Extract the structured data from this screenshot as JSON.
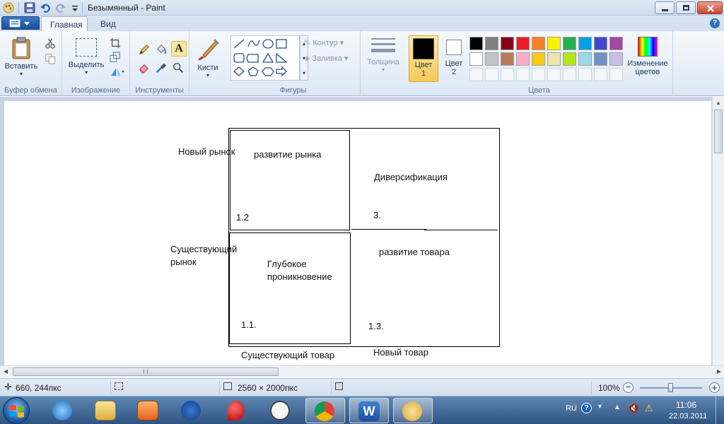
{
  "window": {
    "title": "Безымянный - Paint"
  },
  "tabs": [
    {
      "label": "Главная"
    },
    {
      "label": "Вид"
    }
  ],
  "ribbon": {
    "clipboard": {
      "paste": "Вставить",
      "group": "Буфер обмена"
    },
    "image": {
      "select": "Выделить",
      "group": "Изображение"
    },
    "tools": {
      "group": "Инструменты"
    },
    "brushes": {
      "label": "Кисти"
    },
    "shapes": {
      "outline": "Контур",
      "fill": "Заливка",
      "group": "Фигуры"
    },
    "size": {
      "label": "Толщина"
    },
    "color1": {
      "line1": "Цвет",
      "line2": "1"
    },
    "color2": {
      "line1": "Цвет",
      "line2": "2"
    },
    "colors": {
      "edit_line1": "Изменение",
      "edit_line2": "цветов",
      "group": "Цвета"
    },
    "palette_row1": [
      "#000000",
      "#7f7f7f",
      "#880015",
      "#ed1c24",
      "#ff7f27",
      "#fff200",
      "#22b14c",
      "#00a2e8",
      "#3f48cc",
      "#a349a4"
    ],
    "palette_row2": [
      "#ffffff",
      "#c3c3c3",
      "#b97a57",
      "#ffaec9",
      "#ffc90e",
      "#efe4b0",
      "#b5e61d",
      "#99d9ea",
      "#7092be",
      "#c8bfe7"
    ],
    "color1_value": "#000000",
    "color2_value": "#ffffff"
  },
  "canvas": {
    "labels": {
      "new_market": "Новый рынок",
      "existing_market_1": "Существующий",
      "existing_market_2": "рынок",
      "market_development": "развитие рынка",
      "diversification": "Диверсификация",
      "deep_1": "Глубокое",
      "deep_2": "проникновение",
      "product_development": "развитие товара",
      "num_12": "1.2",
      "num_3": "3.",
      "num_11": "1.1.",
      "num_13": "1.3.",
      "existing_product": "Существующий товар",
      "new_product": "Новый товар"
    }
  },
  "status": {
    "cursor": "660, 244пкс",
    "size": "2560 × 2000пкс",
    "zoom": "100%",
    "zoom_level": 1.0
  },
  "tray": {
    "lang": "RU",
    "time": "11:06",
    "date": "22.03.2011"
  }
}
